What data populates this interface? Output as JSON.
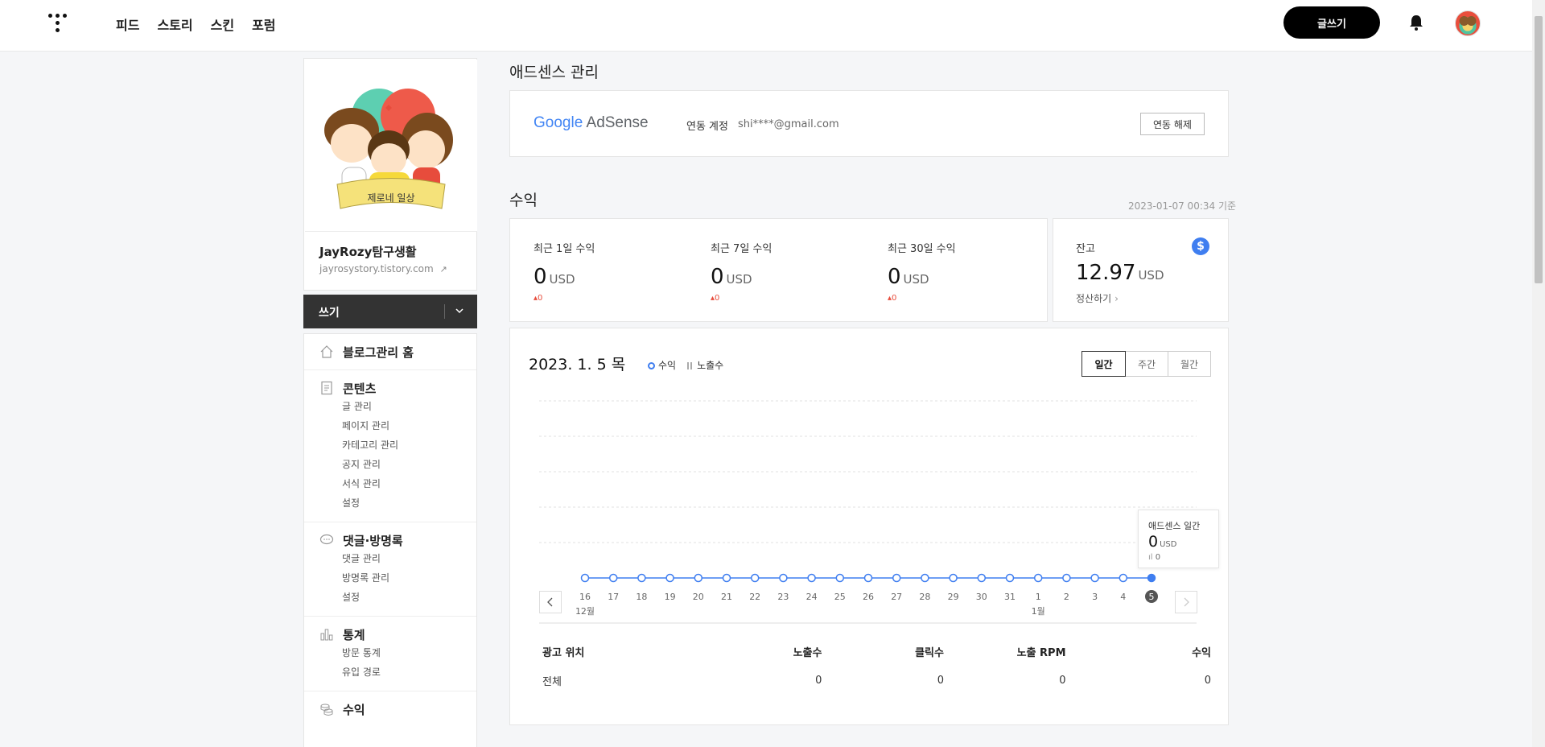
{
  "topnav": {
    "items": [
      "피드",
      "스토리",
      "스킨",
      "포럼"
    ],
    "write_button": "글쓰기"
  },
  "blog": {
    "name": "JayRozy탐구생활",
    "url": "jayrosystory.tistory.com",
    "profile_banner_text": "제로네 일상"
  },
  "write_bar": {
    "label": "쓰기"
  },
  "sidebar": {
    "sections": [
      {
        "title": "블로그관리 홈",
        "icon": "home-icon",
        "items": []
      },
      {
        "title": "콘텐츠",
        "icon": "document-icon",
        "items": [
          "글 관리",
          "페이지 관리",
          "카테고리 관리",
          "공지 관리",
          "서식 관리",
          "설정"
        ]
      },
      {
        "title": "댓글·방명록",
        "icon": "comment-icon",
        "items": [
          "댓글 관리",
          "방명록 관리",
          "설정"
        ]
      },
      {
        "title": "통계",
        "icon": "chart-icon",
        "items": [
          "방문 통계",
          "유입 경로"
        ]
      },
      {
        "title": "수익",
        "icon": "coins-icon",
        "items": []
      }
    ]
  },
  "adsense": {
    "page_title": "애드센스 관리",
    "logo_google": "Google",
    "logo_product": "AdSense",
    "linked_label": "연동 계정",
    "linked_email": "shi****@gmail.com",
    "unlink_button": "연동 해제"
  },
  "earnings": {
    "section_title": "수익",
    "timestamp": "2023-01-07 00:34 기준",
    "cards": [
      {
        "label": "최근 1일 수익",
        "value": "0",
        "unit": "USD",
        "change": "▴0"
      },
      {
        "label": "최근 7일 수익",
        "value": "0",
        "unit": "USD",
        "change": "▴0"
      },
      {
        "label": "최근 30일 수익",
        "value": "0",
        "unit": "USD",
        "change": "▴0"
      }
    ],
    "balance": {
      "label": "잔고",
      "value": "12.97",
      "unit": "USD",
      "settle_link": "정산하기",
      "icon": "dollar-icon"
    }
  },
  "chart": {
    "date_title": "2023. 1. 5 목",
    "legend": [
      "수익",
      "노출수"
    ],
    "period_tabs": [
      "일간",
      "주간",
      "월간"
    ],
    "active_tab": "일간",
    "tooltip": {
      "title": "애드센스 일간",
      "value": "0",
      "unit": "USD",
      "impressions": "0"
    },
    "month_labels": {
      "dec": "12월",
      "jan": "1월"
    },
    "accent_color": "#3f7ef0"
  },
  "chart_data": {
    "type": "line",
    "x": [
      "16",
      "17",
      "18",
      "19",
      "20",
      "21",
      "22",
      "23",
      "24",
      "25",
      "26",
      "27",
      "28",
      "29",
      "30",
      "31",
      "1",
      "2",
      "3",
      "4",
      "5"
    ],
    "series": [
      {
        "name": "수익",
        "values": [
          0,
          0,
          0,
          0,
          0,
          0,
          0,
          0,
          0,
          0,
          0,
          0,
          0,
          0,
          0,
          0,
          0,
          0,
          0,
          0,
          0
        ]
      }
    ],
    "selected_index": 20,
    "grid": true
  },
  "table": {
    "headers": [
      "광고 위치",
      "노출수",
      "클릭수",
      "노출 RPM",
      "수익"
    ],
    "rows": [
      [
        "전체",
        "0",
        "0",
        "0",
        "0"
      ]
    ]
  }
}
